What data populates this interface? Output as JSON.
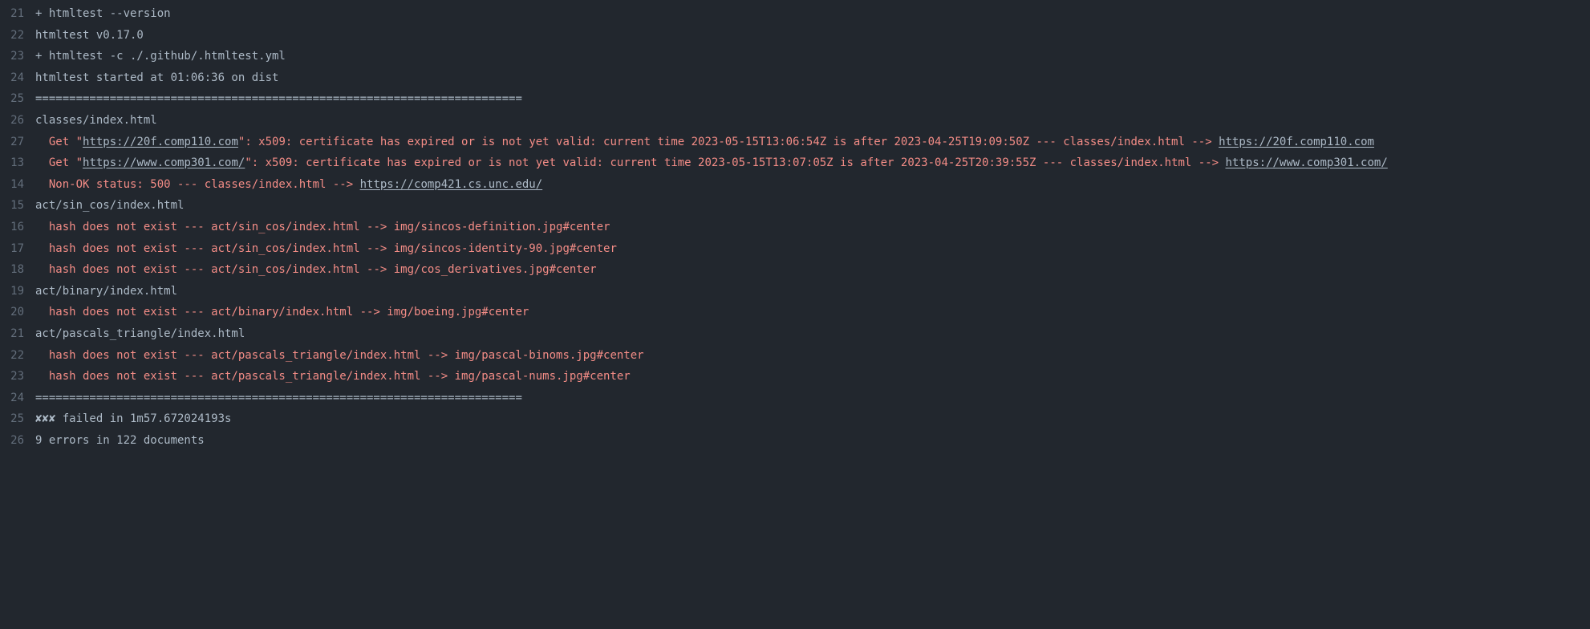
{
  "lines": [
    {
      "num": "21",
      "segments": [
        {
          "text": "+ htmltest --version"
        }
      ]
    },
    {
      "num": "22",
      "segments": [
        {
          "text": "htmltest v0.17.0"
        }
      ]
    },
    {
      "num": "23",
      "segments": [
        {
          "text": "+ htmltest -c ./.github/.htmltest.yml"
        }
      ]
    },
    {
      "num": "24",
      "segments": [
        {
          "text": "htmltest started at 01:06:36 on dist"
        }
      ]
    },
    {
      "num": "25",
      "segments": [
        {
          "text": "========================================================================"
        }
      ]
    },
    {
      "num": "26",
      "segments": [
        {
          "text": "classes/index.html"
        }
      ]
    },
    {
      "num": "27",
      "segments": [
        {
          "text": "  Get \"",
          "cls": "err"
        },
        {
          "text": "https://20f.comp110.com",
          "cls": "err",
          "link": true
        },
        {
          "text": "\": x509: certificate has expired or is not yet valid: current time 2023-05-15T13:06:54Z is after 2023-04-25T19:09:50Z --- classes/index.html --> ",
          "cls": "err"
        },
        {
          "text": "https://20f.comp110.com",
          "cls": "err",
          "link": true
        }
      ]
    },
    {
      "num": "13",
      "segments": [
        {
          "text": "  Get \"",
          "cls": "err"
        },
        {
          "text": "https://www.comp301.com/",
          "cls": "err",
          "link": true
        },
        {
          "text": "\": x509: certificate has expired or is not yet valid: current time 2023-05-15T13:07:05Z is after 2023-04-25T20:39:55Z --- classes/index.html --> ",
          "cls": "err"
        },
        {
          "text": "https://www.comp301.com/",
          "cls": "err",
          "link": true
        }
      ]
    },
    {
      "num": "14",
      "segments": [
        {
          "text": "  Non-OK status: 500 --- classes/index.html --> ",
          "cls": "err"
        },
        {
          "text": "https://comp421.cs.unc.edu/",
          "cls": "err",
          "link": true
        }
      ]
    },
    {
      "num": "15",
      "segments": [
        {
          "text": "act/sin_cos/index.html"
        }
      ]
    },
    {
      "num": "16",
      "segments": [
        {
          "text": "  hash does not exist --- act/sin_cos/index.html --> img/sincos-definition.jpg#center",
          "cls": "err"
        }
      ]
    },
    {
      "num": "17",
      "segments": [
        {
          "text": "  hash does not exist --- act/sin_cos/index.html --> img/sincos-identity-90.jpg#center",
          "cls": "err"
        }
      ]
    },
    {
      "num": "18",
      "segments": [
        {
          "text": "  hash does not exist --- act/sin_cos/index.html --> img/cos_derivatives.jpg#center",
          "cls": "err"
        }
      ]
    },
    {
      "num": "19",
      "segments": [
        {
          "text": "act/binary/index.html"
        }
      ]
    },
    {
      "num": "20",
      "segments": [
        {
          "text": "  hash does not exist --- act/binary/index.html --> img/boeing.jpg#center",
          "cls": "err"
        }
      ]
    },
    {
      "num": "21",
      "segments": [
        {
          "text": "act/pascals_triangle/index.html"
        }
      ]
    },
    {
      "num": "22",
      "segments": [
        {
          "text": "  hash does not exist --- act/pascals_triangle/index.html --> img/pascal-binoms.jpg#center",
          "cls": "err"
        }
      ]
    },
    {
      "num": "23",
      "segments": [
        {
          "text": "  hash does not exist --- act/pascals_triangle/index.html --> img/pascal-nums.jpg#center",
          "cls": "err"
        }
      ]
    },
    {
      "num": "24",
      "segments": [
        {
          "text": "========================================================================"
        }
      ]
    },
    {
      "num": "25",
      "segments": [
        {
          "text": "✘✘✘ failed in 1m57.672024193s"
        }
      ]
    },
    {
      "num": "26",
      "segments": [
        {
          "text": "9 errors in 122 documents"
        }
      ]
    }
  ]
}
